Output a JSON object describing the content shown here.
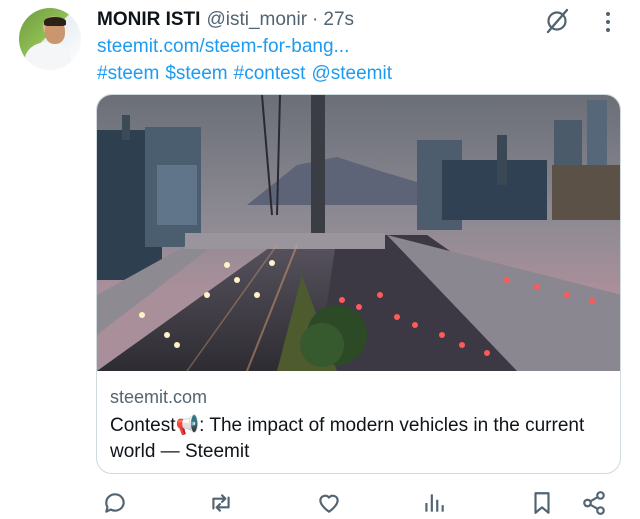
{
  "post": {
    "author_name": "MONIR ISTI",
    "author_handle": "@isti_monir",
    "separator": "·",
    "time": "27s",
    "link_text": "steemit.com/steem-for-bang...",
    "tags": [
      "#steem",
      "$steem",
      "#contest",
      "@steemit"
    ]
  },
  "card": {
    "domain": "steemit.com",
    "title": "Contest📢: The impact of modern vehicles in the current world — Steemit"
  },
  "icons": {
    "grok": "grok-icon",
    "more": "more-vertical-icon",
    "reply": "reply-icon",
    "repost": "repost-icon",
    "like": "like-icon",
    "views": "views-icon",
    "bookmark": "bookmark-icon",
    "share": "share-icon"
  },
  "colors": {
    "accent": "#1d9bf0",
    "secondary_text": "#536471",
    "primary_text": "#0f1419",
    "border": "#cfd9de"
  }
}
